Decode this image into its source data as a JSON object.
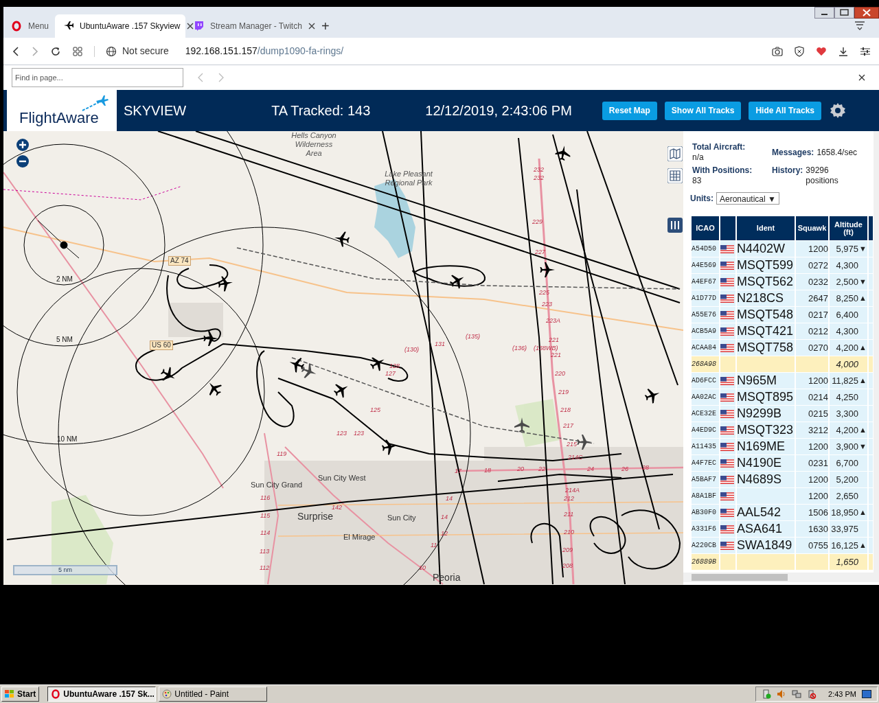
{
  "browser": {
    "tabs": [
      {
        "label": "Menu",
        "kind": "menu",
        "selected": false
      },
      {
        "label": "UbuntuAware .157 Skyview",
        "kind": "plane",
        "selected": true
      },
      {
        "label": "Stream Manager - Twitch",
        "kind": "twitch",
        "selected": false
      }
    ],
    "new_tab": "+",
    "security": "Not secure",
    "url_host": "192.168.151.157",
    "url_path": "/dump1090-fa-rings/",
    "find": {
      "placeholder": "Find in page..."
    }
  },
  "header": {
    "logo": "FlightAware",
    "title": "SKYVIEW",
    "tracked": "TA Tracked: 143",
    "datetime": "12/12/2019, 2:43:06 PM",
    "buttons": [
      "Reset Map",
      "Show All Tracks",
      "Hide All Tracks"
    ]
  },
  "map": {
    "scale": "5 nm",
    "labels": [
      {
        "text": "Hells Canyon Wilderness Area",
        "kind": "area"
      },
      {
        "text": "Lake Pleasant Regional Park",
        "kind": "area"
      },
      {
        "text": "AZ 74",
        "kind": "shield"
      },
      {
        "text": "US 60",
        "kind": "shield"
      },
      {
        "text": "2 NM",
        "kind": "ring"
      },
      {
        "text": "5 NM",
        "kind": "ring"
      },
      {
        "text": "10 NM",
        "kind": "ring"
      },
      {
        "text": "Sun City West",
        "kind": "town"
      },
      {
        "text": "Sun City Grand",
        "kind": "town"
      },
      {
        "text": "Surprise",
        "kind": "city"
      },
      {
        "text": "Sun City",
        "kind": "town"
      },
      {
        "text": "El Mirage",
        "kind": "town"
      },
      {
        "text": "Peoria",
        "kind": "city"
      },
      {
        "text": "232",
        "kind": "exit"
      },
      {
        "text": "232",
        "kind": "exit"
      },
      {
        "text": "229",
        "kind": "exit"
      },
      {
        "text": "227",
        "kind": "exit"
      },
      {
        "text": "225",
        "kind": "exit"
      },
      {
        "text": "223",
        "kind": "exit"
      },
      {
        "text": "223A",
        "kind": "exit"
      },
      {
        "text": "221",
        "kind": "exit"
      },
      {
        "text": "221",
        "kind": "exit"
      },
      {
        "text": "220",
        "kind": "exit"
      },
      {
        "text": "219",
        "kind": "exit"
      },
      {
        "text": "218",
        "kind": "exit"
      },
      {
        "text": "217",
        "kind": "exit"
      },
      {
        "text": "215",
        "kind": "exit"
      },
      {
        "text": "214C",
        "kind": "exit"
      },
      {
        "text": "214A",
        "kind": "exit"
      },
      {
        "text": "212",
        "kind": "exit"
      },
      {
        "text": "211",
        "kind": "exit"
      },
      {
        "text": "210",
        "kind": "exit"
      },
      {
        "text": "209",
        "kind": "exit"
      },
      {
        "text": "208",
        "kind": "exit"
      },
      {
        "text": "(130)",
        "kind": "exit"
      },
      {
        "text": "131",
        "kind": "exit"
      },
      {
        "text": "(135)",
        "kind": "exit"
      },
      {
        "text": "(136)",
        "kind": "exit"
      },
      {
        "text": "(138WB)",
        "kind": "exit"
      },
      {
        "text": "128",
        "kind": "exit"
      },
      {
        "text": "127",
        "kind": "exit"
      },
      {
        "text": "125",
        "kind": "exit"
      },
      {
        "text": "123",
        "kind": "exit"
      },
      {
        "text": "123",
        "kind": "exit"
      },
      {
        "text": "119",
        "kind": "exit"
      },
      {
        "text": "116",
        "kind": "exit"
      },
      {
        "text": "115",
        "kind": "exit"
      },
      {
        "text": "114",
        "kind": "exit"
      },
      {
        "text": "113",
        "kind": "exit"
      },
      {
        "text": "112",
        "kind": "exit"
      },
      {
        "text": "142",
        "kind": "exit"
      },
      {
        "text": "14",
        "kind": "exit"
      },
      {
        "text": "14",
        "kind": "exit"
      },
      {
        "text": "12",
        "kind": "exit"
      },
      {
        "text": "11",
        "kind": "exit"
      },
      {
        "text": "10",
        "kind": "exit"
      },
      {
        "text": "17",
        "kind": "exit"
      },
      {
        "text": "18",
        "kind": "exit"
      },
      {
        "text": "20",
        "kind": "exit"
      },
      {
        "text": "22",
        "kind": "exit"
      },
      {
        "text": "24",
        "kind": "exit"
      },
      {
        "text": "26",
        "kind": "exit"
      },
      {
        "text": "28",
        "kind": "exit"
      }
    ]
  },
  "stats": [
    {
      "label": "Total Aircraft:",
      "value": "n/a"
    },
    {
      "label": "Messages:",
      "value": "1658.4/sec"
    },
    {
      "label": "With Positions:",
      "value": "83"
    },
    {
      "label": "History:",
      "value": "39296 positions"
    }
  ],
  "units": {
    "label": "Units:",
    "value": "Aeronautical ▼"
  },
  "table": {
    "columns": [
      "ICAO",
      "Ident",
      "Squawk",
      "Altitude (ft)"
    ],
    "rows": [
      {
        "icao": "A54D50",
        "flag": true,
        "ident": "N4402W",
        "squawk": "1200",
        "altitude": "5,975",
        "trend": "▼",
        "highlighted": false
      },
      {
        "icao": "A4E569",
        "flag": true,
        "ident": "MSQT599",
        "squawk": "0272",
        "altitude": "4,300",
        "highlighted": false
      },
      {
        "icao": "A4EF67",
        "flag": true,
        "ident": "MSQT562",
        "squawk": "0232",
        "altitude": "2,500",
        "trend": "▼",
        "highlighted": false
      },
      {
        "icao": "A1D77D",
        "flag": true,
        "ident": "N218CS",
        "squawk": "2647",
        "altitude": "8,250",
        "trend": "▲",
        "highlighted": false
      },
      {
        "icao": "A55E76",
        "flag": true,
        "ident": "MSQT548",
        "squawk": "0217",
        "altitude": "6,400",
        "highlighted": false
      },
      {
        "icao": "ACB5A9",
        "flag": true,
        "ident": "MSQT421",
        "squawk": "0212",
        "altitude": "4,300",
        "highlighted": false
      },
      {
        "icao": "ACAA84",
        "flag": true,
        "ident": "MSQT758",
        "squawk": "0270",
        "altitude": "4,200",
        "trend": "▲",
        "highlighted": false
      },
      {
        "icao": "268A98",
        "flag": false,
        "altitude": "4,000",
        "highlighted": true
      },
      {
        "icao": "AD6FCC",
        "flag": true,
        "ident": "N965M",
        "squawk": "1200",
        "altitude": "11,825",
        "trend": "▲",
        "highlighted": false
      },
      {
        "icao": "AA02AC",
        "flag": true,
        "ident": "MSQT895",
        "squawk": "0214",
        "altitude": "4,250",
        "highlighted": false
      },
      {
        "icao": "ACE32E",
        "flag": true,
        "ident": "N9299B",
        "squawk": "0215",
        "altitude": "3,300",
        "highlighted": false
      },
      {
        "icao": "A4ED9C",
        "flag": true,
        "ident": "MSQT323",
        "squawk": "3212",
        "altitude": "4,200",
        "trend": "▲",
        "highlighted": false
      },
      {
        "icao": "A11435",
        "flag": true,
        "ident": "N169ME",
        "squawk": "1200",
        "altitude": "3,900",
        "trend": "▼",
        "highlighted": false
      },
      {
        "icao": "A4F7EC",
        "flag": true,
        "ident": "N4190E",
        "squawk": "0231",
        "altitude": "6,700",
        "highlighted": false
      },
      {
        "icao": "A5BAF7",
        "flag": true,
        "ident": "N4689S",
        "squawk": "1200",
        "altitude": "5,200",
        "highlighted": false
      },
      {
        "icao": "A8A1BF",
        "flag": true,
        "squawk": "1200",
        "altitude": "2,650",
        "highlighted": false
      },
      {
        "icao": "AB30F0",
        "flag": true,
        "ident": "AAL542",
        "squawk": "1506",
        "altitude": "18,950",
        "trend": "▲",
        "highlighted": false
      },
      {
        "icao": "A331F6",
        "flag": true,
        "ident": "ASA641",
        "squawk": "1630",
        "altitude": "33,975",
        "highlighted": false
      },
      {
        "icao": "A220CB",
        "flag": true,
        "ident": "SWA1849",
        "squawk": "0755",
        "altitude": "16,125",
        "trend": "▲",
        "highlighted": false
      },
      {
        "icao": "26889B",
        "flag": false,
        "altitude": "1,650",
        "highlighted": true
      }
    ]
  },
  "taskbar": {
    "start": "Start",
    "items": [
      {
        "label": "UbuntuAware .157 Sk...",
        "kind": "opera",
        "selected": true
      },
      {
        "label": "Untitled - Paint",
        "kind": "paint",
        "selected": false
      }
    ],
    "clock": "2:43 PM"
  }
}
